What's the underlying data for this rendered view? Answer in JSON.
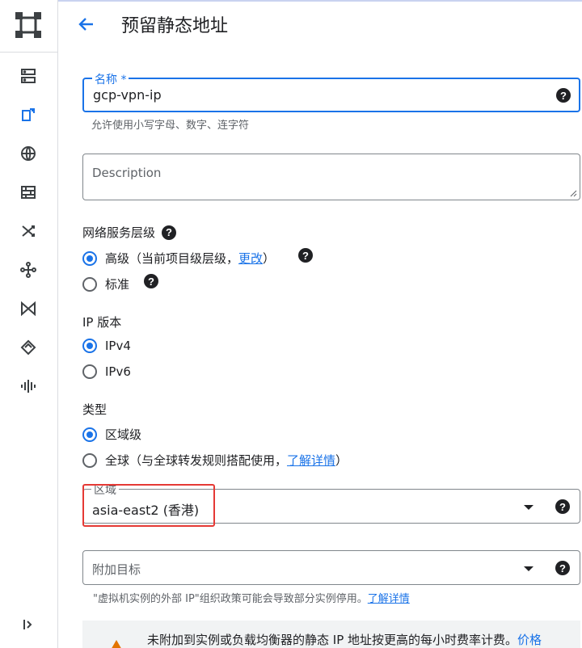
{
  "header": {
    "title": "预留静态地址"
  },
  "rail": {
    "items": [
      {
        "icon": "instances-icon"
      },
      {
        "icon": "ip-addresses-icon"
      },
      {
        "icon": "network-globe-icon"
      },
      {
        "icon": "firewall-icon"
      },
      {
        "icon": "routes-icon"
      },
      {
        "icon": "peering-icon"
      },
      {
        "icon": "vpn-icon"
      },
      {
        "icon": "security-icon"
      },
      {
        "icon": "packet-mirroring-icon"
      }
    ],
    "expand_icon": "expand-rail-icon"
  },
  "name_field": {
    "label": "名称 *",
    "value": "gcp-vpn-ip",
    "hint": "允许使用小写字母、数字、连字符"
  },
  "description_field": {
    "placeholder": "Description"
  },
  "network_tier": {
    "title": "网络服务层级",
    "premium_label": "高级（当前项目级层级，",
    "premium_link": "更改",
    "premium_suffix": "）",
    "standard_label": "标准",
    "selected": "premium"
  },
  "ip_version": {
    "title": "IP 版本",
    "options": [
      "IPv4",
      "IPv6"
    ],
    "selected": "IPv4"
  },
  "type": {
    "title": "类型",
    "regional_label": "区域级",
    "global_label": "全球（与全球转发规则搭配使用，",
    "global_link": "了解详情",
    "global_suffix": "）",
    "selected": "regional"
  },
  "region_field": {
    "label": "区域",
    "value": "asia-east2 (香港)"
  },
  "attach_field": {
    "placeholder": "附加目标",
    "hint": "\"虚拟机实例的外部 IP\"组织政策可能会导致部分实例停用。",
    "hint_link": "了解详情"
  },
  "notice": {
    "text": "未附加到实例或负载均衡器的静态 IP 地址按更高的每小时费率计费。",
    "link": "价格"
  },
  "colors": {
    "accent": "#1a73e8",
    "highlight_box": "#e53935",
    "warning": "#e37400"
  }
}
